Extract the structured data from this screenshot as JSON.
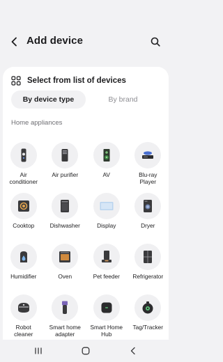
{
  "header": {
    "title": "Add device",
    "back_icon": "back-arrow-icon",
    "search_icon": "search-icon"
  },
  "list_option": {
    "label": "Select from list of devices",
    "icon": "grid-list-icon"
  },
  "tabs": [
    {
      "label": "By device type",
      "active": true
    },
    {
      "label": "By brand",
      "active": false
    }
  ],
  "section": {
    "title": "Home appliances"
  },
  "devices": [
    {
      "label": "Air\nconditioner",
      "icon": "air-conditioner-icon"
    },
    {
      "label": "Air purifier",
      "icon": "air-purifier-icon"
    },
    {
      "label": "AV",
      "icon": "speaker-icon"
    },
    {
      "label": "Blu-ray\nPlayer",
      "icon": "blu-ray-player-icon"
    },
    {
      "label": "Cooktop",
      "icon": "cooktop-icon"
    },
    {
      "label": "Dishwasher",
      "icon": "dishwasher-icon"
    },
    {
      "label": "Display",
      "icon": "display-icon"
    },
    {
      "label": "Dryer",
      "icon": "dryer-icon"
    },
    {
      "label": "Humidifier",
      "icon": "humidifier-icon"
    },
    {
      "label": "Oven",
      "icon": "oven-icon"
    },
    {
      "label": "Pet feeder",
      "icon": "pet-feeder-icon"
    },
    {
      "label": "Refrigerator",
      "icon": "refrigerator-icon"
    },
    {
      "label": "Robot\ncleaner",
      "icon": "robot-cleaner-icon"
    },
    {
      "label": "Smart home\nadapter",
      "icon": "smart-home-adapter-icon"
    },
    {
      "label": "Smart Home\nHub",
      "icon": "smart-home-hub-icon"
    },
    {
      "label": "Tag/Tracker",
      "icon": "tag-tracker-icon"
    }
  ],
  "colors": {
    "background": "#f2f2f4",
    "card": "#ffffff",
    "tile_circle": "#f0f0f2",
    "active_tab": "#f1f1f3",
    "accent_blue": "#3d6fd9",
    "inactive_text": "#8e8e93"
  },
  "navbar": {
    "recents_icon": "recents-icon",
    "home_icon": "home-icon",
    "back_icon": "nav-back-icon"
  }
}
